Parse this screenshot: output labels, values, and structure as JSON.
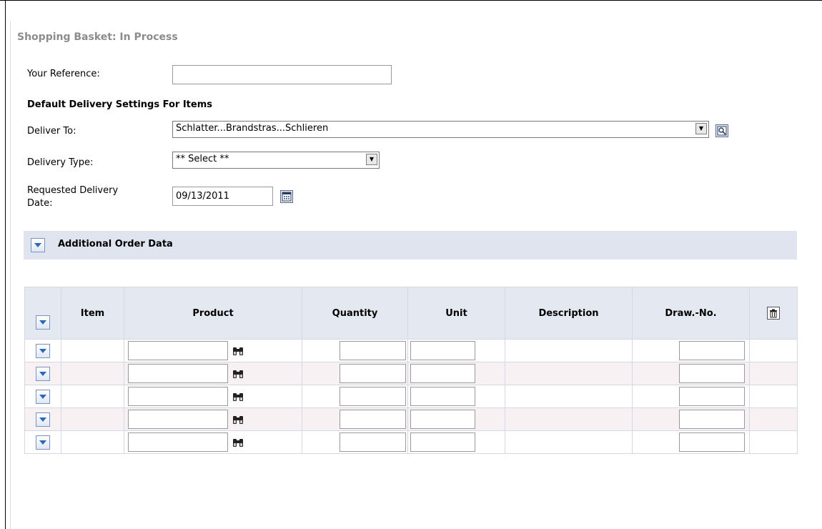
{
  "page": {
    "title": "Shopping Basket: In Process"
  },
  "form": {
    "reference_label": "Your Reference:",
    "reference_value": "",
    "defaults_heading": "Default Delivery Settings For Items",
    "deliver_to_label": "Deliver To:",
    "deliver_to_value": "Schlatter...Brandstras...Schlieren",
    "delivery_type_label": "Delivery Type:",
    "delivery_type_value": "** Select **",
    "requested_date_label_line1": "Requested Delivery",
    "requested_date_label_line2": "Date:",
    "requested_date_value": "09/13/2011"
  },
  "additional_section": {
    "title": "Additional Order Data"
  },
  "table": {
    "headers": {
      "item": "Item",
      "product": "Product",
      "quantity": "Quantity",
      "unit": "Unit",
      "description": "Description",
      "draw_no": "Draw.-No."
    },
    "rows": [
      {
        "item": "",
        "product": "",
        "quantity": "",
        "unit": "",
        "description": "",
        "draw_no": ""
      },
      {
        "item": "",
        "product": "",
        "quantity": "",
        "unit": "",
        "description": "",
        "draw_no": ""
      },
      {
        "item": "",
        "product": "",
        "quantity": "",
        "unit": "",
        "description": "",
        "draw_no": ""
      },
      {
        "item": "",
        "product": "",
        "quantity": "",
        "unit": "",
        "description": "",
        "draw_no": ""
      },
      {
        "item": "",
        "product": "",
        "quantity": "",
        "unit": "",
        "description": "",
        "draw_no": ""
      }
    ]
  },
  "icons": {
    "deliver_to_lookup": "address-lookup-icon",
    "calendar": "calendar-icon",
    "expand": "chevron-down-icon",
    "delete": "trash-icon",
    "product_search": "binoculars-icon"
  },
  "colors": {
    "section_bar": "#dfe4ef",
    "header_bg": "#e4e8f1",
    "alt_row": "#f8f1f3",
    "title_gray": "#8c8c8c"
  }
}
